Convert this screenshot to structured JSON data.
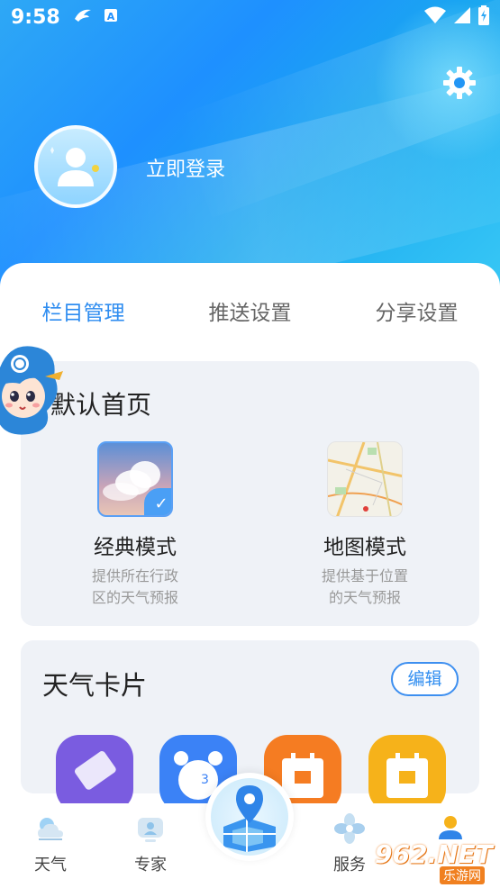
{
  "status_bar": {
    "time": "9:58",
    "icons": [
      "notification-bird-icon",
      "app-a-icon",
      "wifi-icon",
      "signal-icon",
      "battery-charging-icon"
    ]
  },
  "header": {
    "settings_icon": "gear-icon",
    "login_label": "立即登录"
  },
  "tabs": [
    {
      "label": "栏目管理",
      "active": true
    },
    {
      "label": "推送设置",
      "active": false
    },
    {
      "label": "分享设置",
      "active": false
    }
  ],
  "default_home": {
    "title": "默认首页",
    "modes": [
      {
        "name": "经典模式",
        "desc_line1": "提供所在行政",
        "desc_line2": "区的天气预报",
        "selected": true
      },
      {
        "name": "地图模式",
        "desc_line1": "提供基于位置",
        "desc_line2": "的天气预报",
        "selected": false
      }
    ]
  },
  "weather_cards": {
    "title": "天气卡片",
    "edit_label": "编辑",
    "icons": [
      {
        "name": "tag-card-icon",
        "color": "#7a5ce0"
      },
      {
        "name": "alarm-clock-card-icon",
        "color": "#3b82f6"
      },
      {
        "name": "calendar-card-icon",
        "color": "#f57c22"
      },
      {
        "name": "calendar-yellow-card-icon",
        "color": "#f6b21a"
      }
    ]
  },
  "bottom_nav": {
    "items": [
      {
        "label": "天气",
        "icon": "weather-cloud-icon"
      },
      {
        "label": "专家",
        "icon": "expert-icon"
      },
      {
        "label": "",
        "icon": "map-location-icon"
      },
      {
        "label": "服务",
        "icon": "service-flower-icon"
      },
      {
        "label": "",
        "icon": "user-profile-icon"
      }
    ]
  },
  "watermark": {
    "text": "962.NET",
    "subtext": "乐游网"
  },
  "colors": {
    "accent": "#2f8df0",
    "header_blue": "#1e90ff"
  }
}
